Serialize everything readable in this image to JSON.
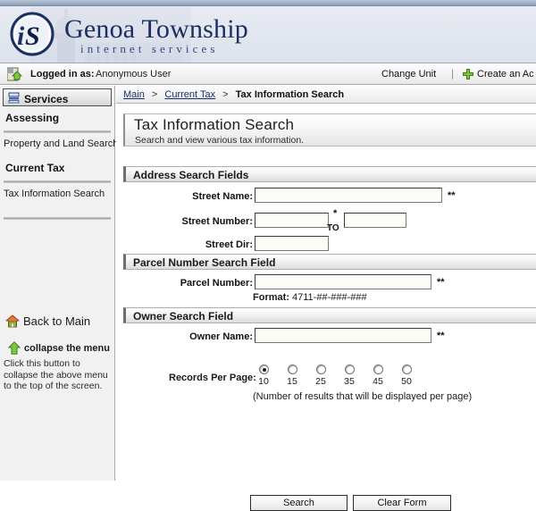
{
  "brand": {
    "logo_text": "iS",
    "name": "Genoa Township",
    "tagline": "internet services"
  },
  "loginbar": {
    "icon": "login-user-icon",
    "logged_in_label": "Logged in as:",
    "user": "Anonymous User",
    "change_unit": "Change Unit",
    "separator": "|",
    "plus_icon": "plus-icon",
    "create_account": "Create an Ac"
  },
  "sidebar": {
    "tab": {
      "icon": "services-icon",
      "label": "Services"
    },
    "groups": [
      {
        "title": "Assessing",
        "links": [
          "Property and Land Search"
        ]
      },
      {
        "title": "Current Tax",
        "links": [
          "Tax Information Search"
        ]
      }
    ],
    "back_to_main": {
      "icon": "house-icon",
      "label": "Back to Main"
    },
    "collapse": {
      "icon": "green-up-arrow-icon",
      "label": "collapse the menu",
      "help": "Click this button to collapse the above menu to the top of the screen."
    }
  },
  "breadcrumb": {
    "items": [
      "Main",
      "Current Tax",
      "Tax Information Search"
    ],
    "separator": ">"
  },
  "page": {
    "title": "Tax Information Search",
    "subtitle": "Search and view various tax information."
  },
  "sections": {
    "address": {
      "header": "Address Search Fields",
      "street_name": {
        "label": "Street Name:",
        "value": "",
        "marker": "**"
      },
      "street_number": {
        "label": "Street Number:",
        "value": "",
        "marker": "*",
        "to": "TO",
        "value_to": ""
      },
      "street_dir": {
        "label": "Street Dir:",
        "value": ""
      }
    },
    "parcel": {
      "header": "Parcel Number Search Field",
      "parcel_number": {
        "label": "Parcel Number:",
        "value": "",
        "marker": "**"
      },
      "format_label": "Format:",
      "format_value": "4711-##-###-###"
    },
    "owner": {
      "header": "Owner Search Field",
      "owner_name": {
        "label": "Owner Name:",
        "value": "",
        "marker": "**"
      }
    }
  },
  "records_per_page": {
    "label": "Records Per Page:",
    "options": [
      "10",
      "15",
      "25",
      "35",
      "45",
      "50"
    ],
    "selected": "10",
    "note": "(Number of results that will be displayed per page)"
  },
  "buttons": {
    "search": "Search",
    "clear": "Clear Form"
  },
  "colors": {
    "brand_navy": "#1b2f63",
    "banner_stripe": "#9badc4",
    "banner_body": "#e2e6ee",
    "link": "#17306b",
    "accent_green": "#6ab83a"
  }
}
